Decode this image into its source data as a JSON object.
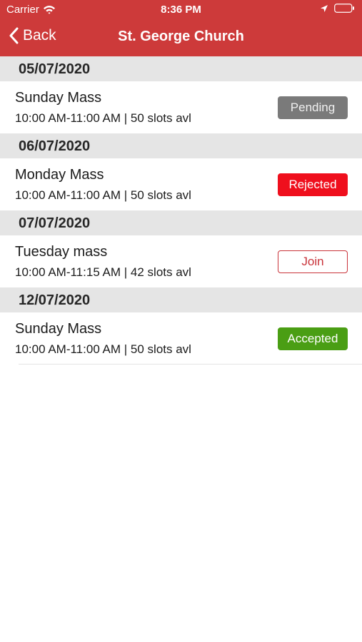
{
  "status_bar": {
    "carrier": "Carrier",
    "time": "8:36 PM"
  },
  "nav": {
    "back_label": "Back",
    "title": "St. George Church"
  },
  "colors": {
    "nav_bg": "#cd3a3a",
    "pending": "#7a7a7a",
    "rejected": "#ef0f1d",
    "join": "#c9333a",
    "accepted": "#4a9e14"
  },
  "icons": {
    "wifi": "wifi-icon",
    "location": "location-arrow-icon",
    "battery": "battery-icon",
    "back": "chevron-left-icon"
  },
  "sections": [
    {
      "date": "05/07/2020",
      "title": "Sunday Mass",
      "details": "10:00 AM-11:00 AM | 50 slots avl",
      "status": "Pending"
    },
    {
      "date": "06/07/2020",
      "title": "Monday Mass",
      "details": "10:00 AM-11:00 AM | 50 slots avl",
      "status": "Rejected"
    },
    {
      "date": "07/07/2020",
      "title": "Tuesday mass",
      "details": "10:00 AM-11:15 AM | 42 slots avl",
      "status": "Join"
    },
    {
      "date": "12/07/2020",
      "title": "Sunday Mass",
      "details": "10:00 AM-11:00 AM | 50 slots avl",
      "status": "Accepted"
    }
  ]
}
